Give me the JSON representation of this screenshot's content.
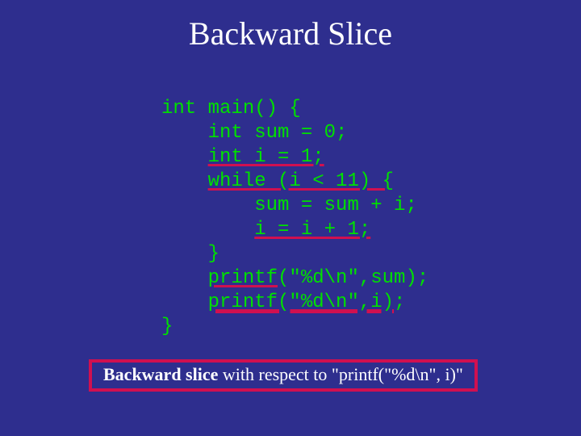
{
  "title": "Backward Slice",
  "code": {
    "l1": "int main() {",
    "l2": "    int sum = 0;",
    "l3a": "    ",
    "l3b": "int i = 1;",
    "l4a": "    ",
    "l4b": "while (i < 11) {",
    "l5": "        sum = sum + i;",
    "l6a": "        ",
    "l6b": "i = i + 1;",
    "l7": "    }",
    "l8a": "    ",
    "l8b": "printf",
    "l8c": "(\"%d\\n\",sum);",
    "l9a": "    ",
    "l9b": "printf(\"%d\\n\",i)",
    "l9c": ";",
    "l10": "}"
  },
  "caption": {
    "bold": "Backward slice",
    "rest": " with respect to \"printf(\"%d\\n\", i)\""
  }
}
